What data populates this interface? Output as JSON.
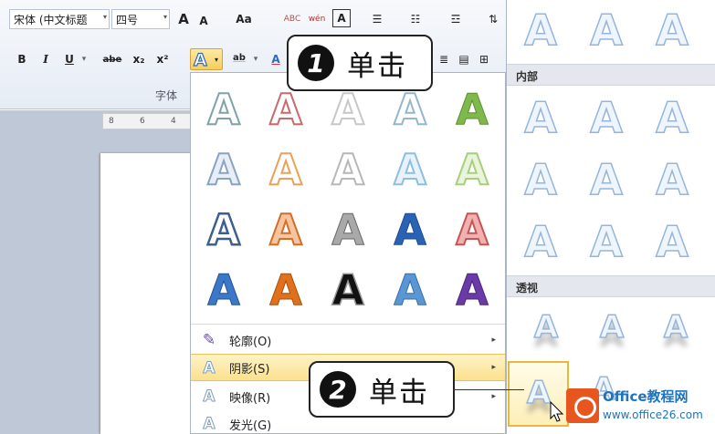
{
  "ribbon": {
    "font_name": "宋体 (中文标题",
    "font_size": "四号",
    "grow_font": "A",
    "shrink_font": "A",
    "change_case": "Aa",
    "clear_format": "ABC",
    "phonetic": "wén",
    "char_border": "A",
    "bold": "B",
    "italic": "I",
    "underline": "U",
    "strikethrough": "abe",
    "subscript": "x₂",
    "superscript": "x²",
    "highlight": "ab",
    "font_color": "A",
    "group_label": "字体"
  },
  "ruler": {
    "ticks": [
      "8",
      "6",
      "4"
    ]
  },
  "text_effect_button": {
    "glyph": "A"
  },
  "gallery": {
    "glyph": "A",
    "menu": [
      {
        "label": "轮廓(O)",
        "icon": "pencil-icon",
        "highlighted": false
      },
      {
        "label": "阴影(S)",
        "icon": "shadow-a-icon",
        "highlighted": true
      },
      {
        "label": "映像(R)",
        "icon": "reflection-a-icon",
        "highlighted": false
      },
      {
        "label": "发光(G)",
        "icon": "glow-a-icon",
        "highlighted": false
      }
    ],
    "submenu_arrow": "▸"
  },
  "submenu": {
    "glyph": "A",
    "section_inner": "内部",
    "section_perspective": "透视"
  },
  "callouts": {
    "one": {
      "number": "1",
      "text": "单击"
    },
    "two": {
      "number": "2",
      "text": "单击"
    }
  },
  "watermark": {
    "title": "Office教程网",
    "url": "www.office26.com"
  },
  "colors": {
    "accent_blue": "#2f6ac0",
    "highlight": "#fbe18d",
    "orange": "#e0701c"
  }
}
